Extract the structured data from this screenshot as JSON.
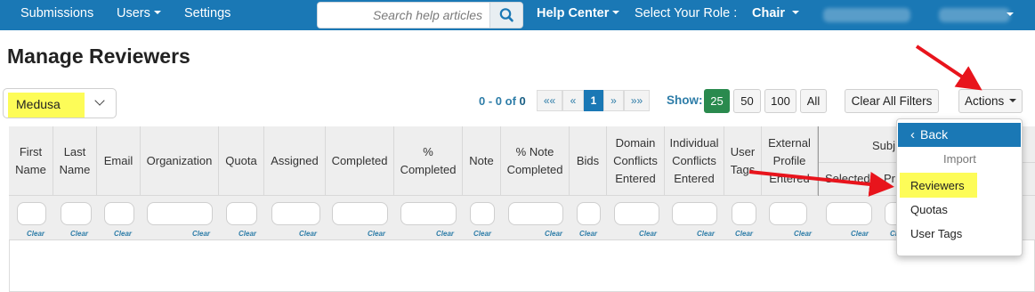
{
  "nav": {
    "submissions": "Submissions",
    "users": "Users",
    "settings": "Settings",
    "search_placeholder": "Search help articles",
    "help_center": "Help Center",
    "role_label": "Select Your Role :",
    "role_value": "Chair",
    "brand_color": "#1a78b5"
  },
  "page": {
    "title": "Manage Reviewers"
  },
  "conference": {
    "selected": "Medusa"
  },
  "pager": {
    "info_prefix": "0 - 0 of ",
    "info_total": "0",
    "first": "««",
    "prev": "«",
    "current": "1",
    "next": "»",
    "last": "»»"
  },
  "show": {
    "label": "Show:",
    "options": [
      "25",
      "50",
      "100",
      "All"
    ],
    "selected": "25"
  },
  "toolbar": {
    "clear_all": "Clear All Filters",
    "actions": "Actions"
  },
  "table": {
    "columns": [
      "First\nName",
      "Last\nName",
      "Email",
      "Organization",
      "Quota",
      "Assigned",
      "Completed",
      "%\nCompleted",
      "Note",
      "% Note\nCompleted",
      "Bids",
      "Domain\nConflicts\nEntered",
      "Individual\nConflicts\nEntered",
      "User\nTags",
      "External\nProfile\nEntered"
    ],
    "subject_group": "Subj",
    "subject_sub": [
      "Selected",
      "Pr"
    ],
    "clear_label": "Clear"
  },
  "actions_menu": {
    "back": "Back",
    "section": "Import",
    "items": [
      "Reviewers",
      "Quotas",
      "User Tags"
    ],
    "highlighted": "Reviewers"
  },
  "colors": {
    "highlight": "#fdfc58",
    "arrow": "#e8141c",
    "active_green": "#2a8a4e"
  }
}
